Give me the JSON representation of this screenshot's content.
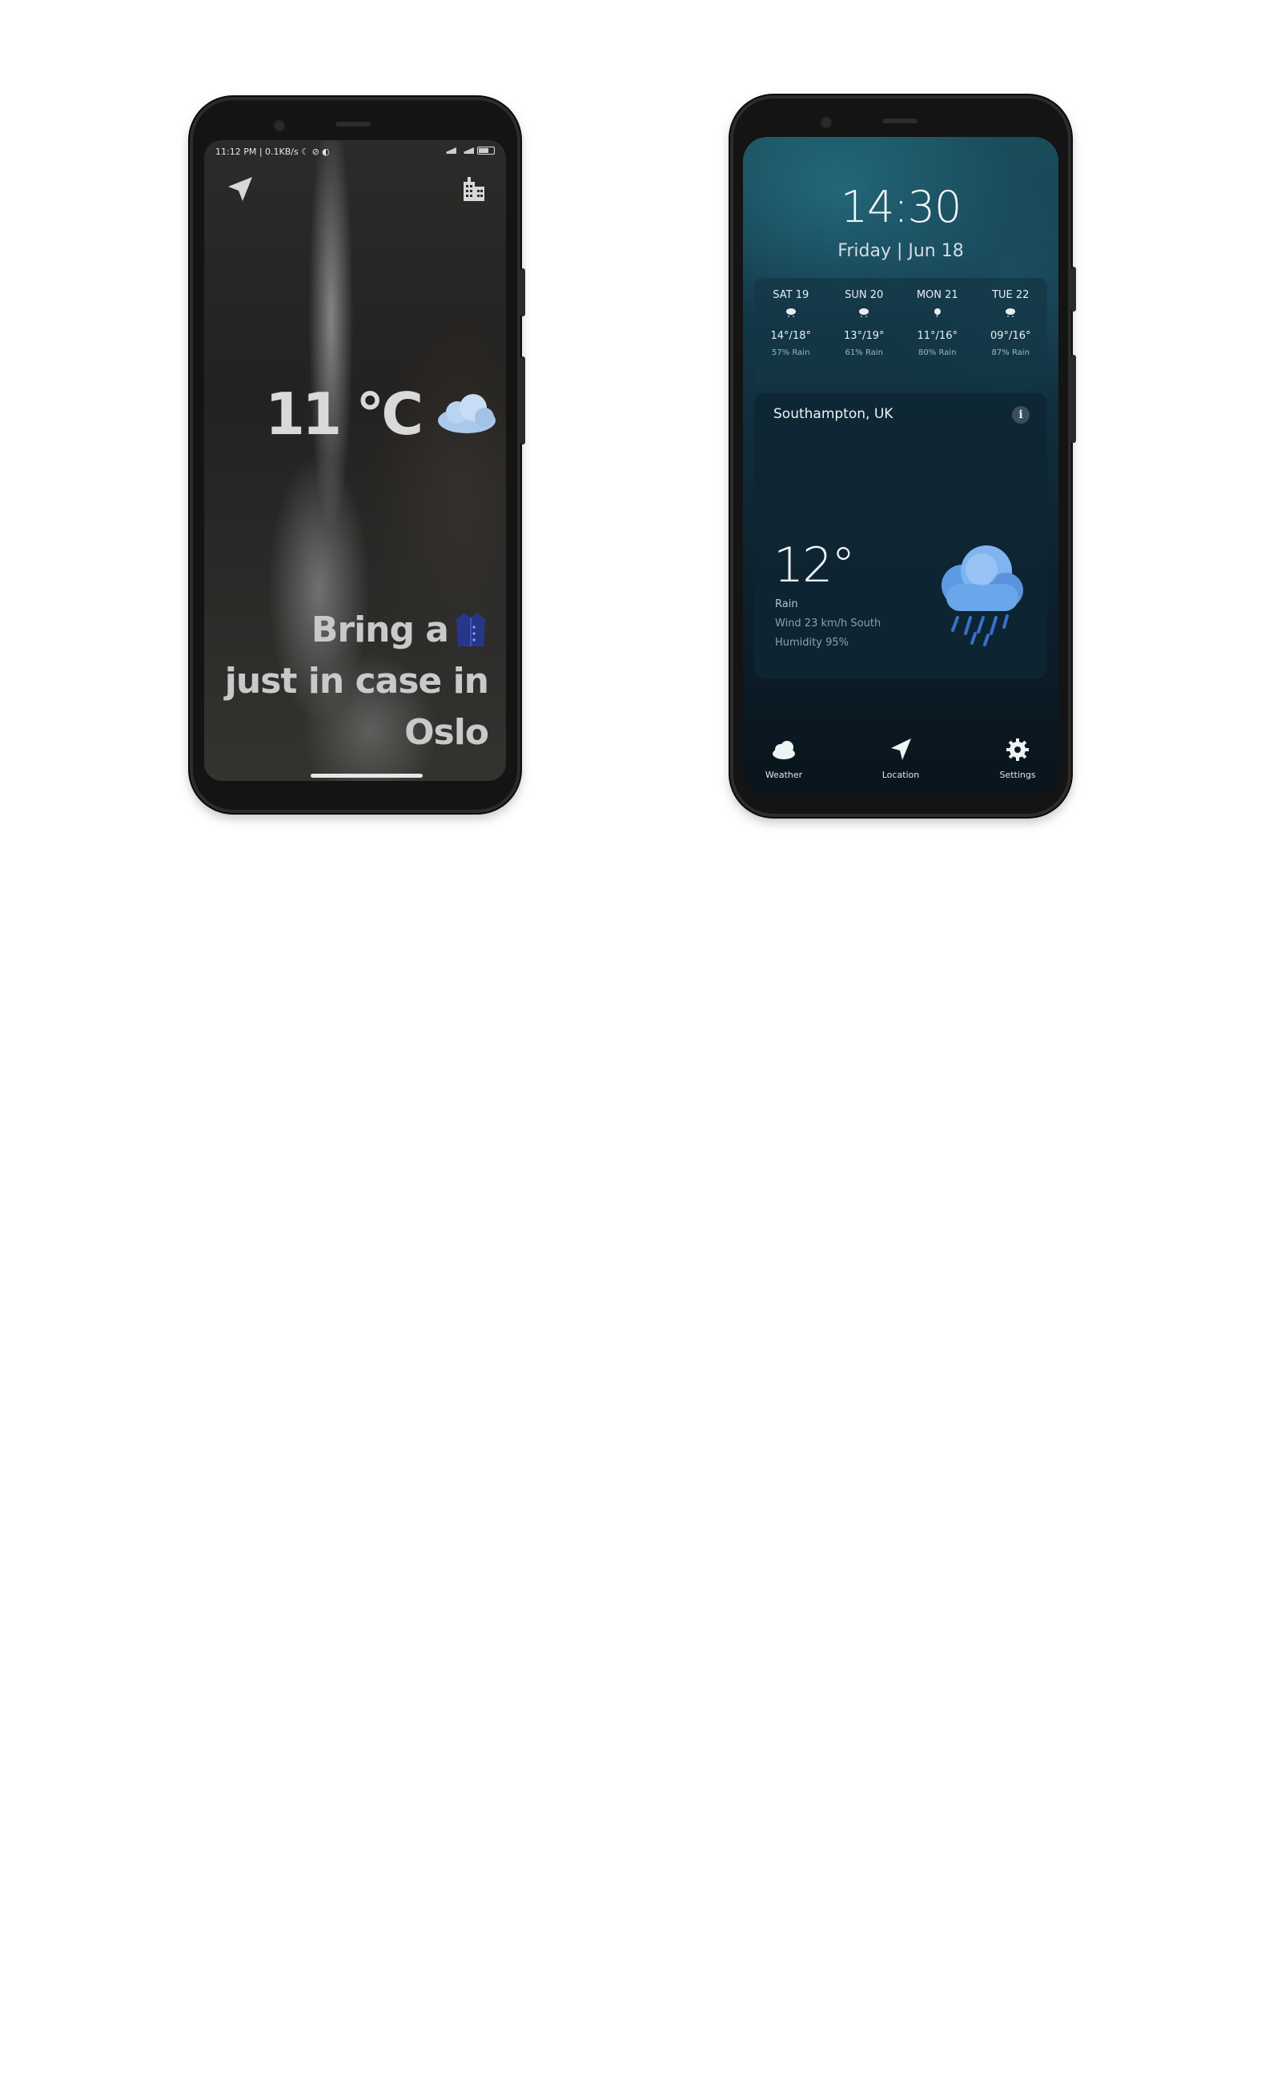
{
  "screen1": {
    "status_left": "11:12 PM | 0.1KB/s ☾ ⊘ ◐",
    "temperature": "11 °C",
    "message_line1": "Bring a",
    "message_line2": "just in case in",
    "message_line3": "Oslo",
    "icons": {
      "location": "navigation-arrow-icon",
      "city": "city-buildings-icon",
      "weather": "cloud-icon",
      "clothing": "raincoat-icon"
    }
  },
  "screen2": {
    "time": "14:30",
    "date": "Friday | Jun 18",
    "forecast": [
      {
        "day": "SAT 19",
        "temp": "14°/18°",
        "rain": "57% Rain"
      },
      {
        "day": "SUN 20",
        "temp": "13°/19°",
        "rain": "61% Rain"
      },
      {
        "day": "MON 21",
        "temp": "11°/16°",
        "rain": "80% Rain"
      },
      {
        "day": "TUE 22",
        "temp": "09°/16°",
        "rain": "87% Rain"
      }
    ],
    "location": "Southampton, UK",
    "info_label": "i",
    "current_temp": "12°",
    "condition": "Rain",
    "wind": "Wind 23 km/h South",
    "humidity": "Humidity 95%",
    "nav": [
      {
        "label": "Weather",
        "icon": "cloud-icon"
      },
      {
        "label": "Location",
        "icon": "navigation-arrow-icon"
      },
      {
        "label": "Settings",
        "icon": "gear-icon"
      }
    ]
  }
}
